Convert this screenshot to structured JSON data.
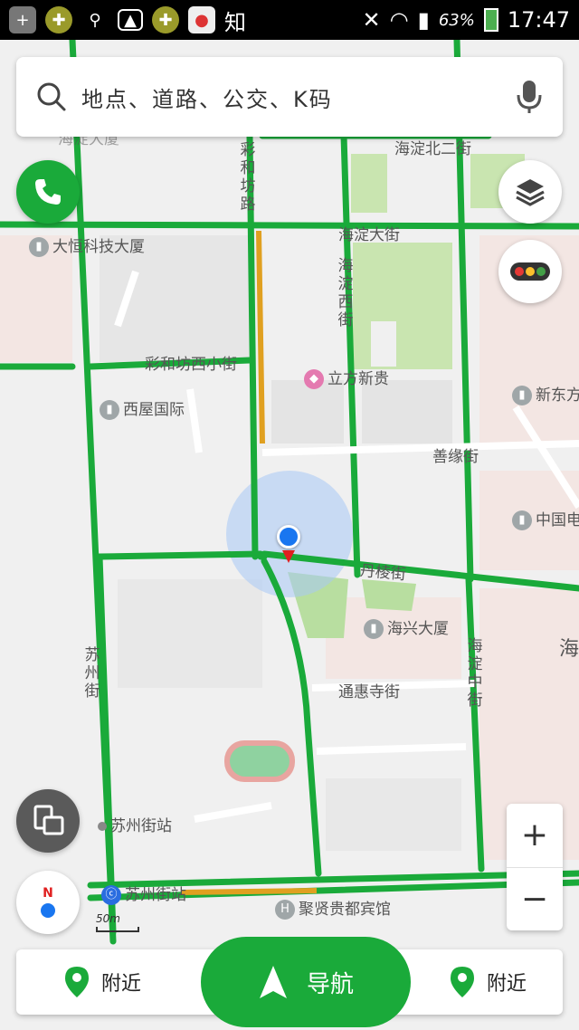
{
  "status_bar": {
    "icons": [
      "plus-box-icon",
      "clover-icon",
      "usb-icon",
      "image-icon",
      "clover-icon",
      "baidu-map-icon"
    ],
    "app_label": "知",
    "battery_percent": "63%",
    "time": "17:47"
  },
  "search": {
    "placeholder": "地点、道路、公交、K码"
  },
  "map_labels": {
    "dahang": "大恒科技大厦",
    "caihefang_xi": "彩和坊西小街",
    "xiwu": "西屋国际",
    "lifang": "立方新贵",
    "xindongfang": "新东方",
    "zhongguo": "中国电",
    "shanyuan": "善缘街",
    "danleng": "丹棱街",
    "haixing": "海兴大厦",
    "tonghuisi": "通惠寺街",
    "hai": "海",
    "suzhoujie_station": "苏州街站",
    "subway_station": "苏州街站",
    "juxian": "聚贤贵都宾馆",
    "haidian_bei": "海淀北二街",
    "haidian_da": "海淀大街",
    "caihefang_lu": "彩和坊路",
    "haidian_xi": "海淀西街",
    "suzhoujie": "苏州街",
    "haidian_zhong": "海淀中街",
    "top_cut": "海淀大厦"
  },
  "compass": {
    "north": "N"
  },
  "zoom": {
    "in": "+",
    "out": "−"
  },
  "scale": {
    "label": "50m"
  },
  "bottom": {
    "nearby_left": "附近",
    "navigate": "导航",
    "nearby_right": "附近"
  },
  "colors": {
    "road_green": "#1aaa3a",
    "accent": "#1aaa3a",
    "location_blue": "#1976f0"
  }
}
